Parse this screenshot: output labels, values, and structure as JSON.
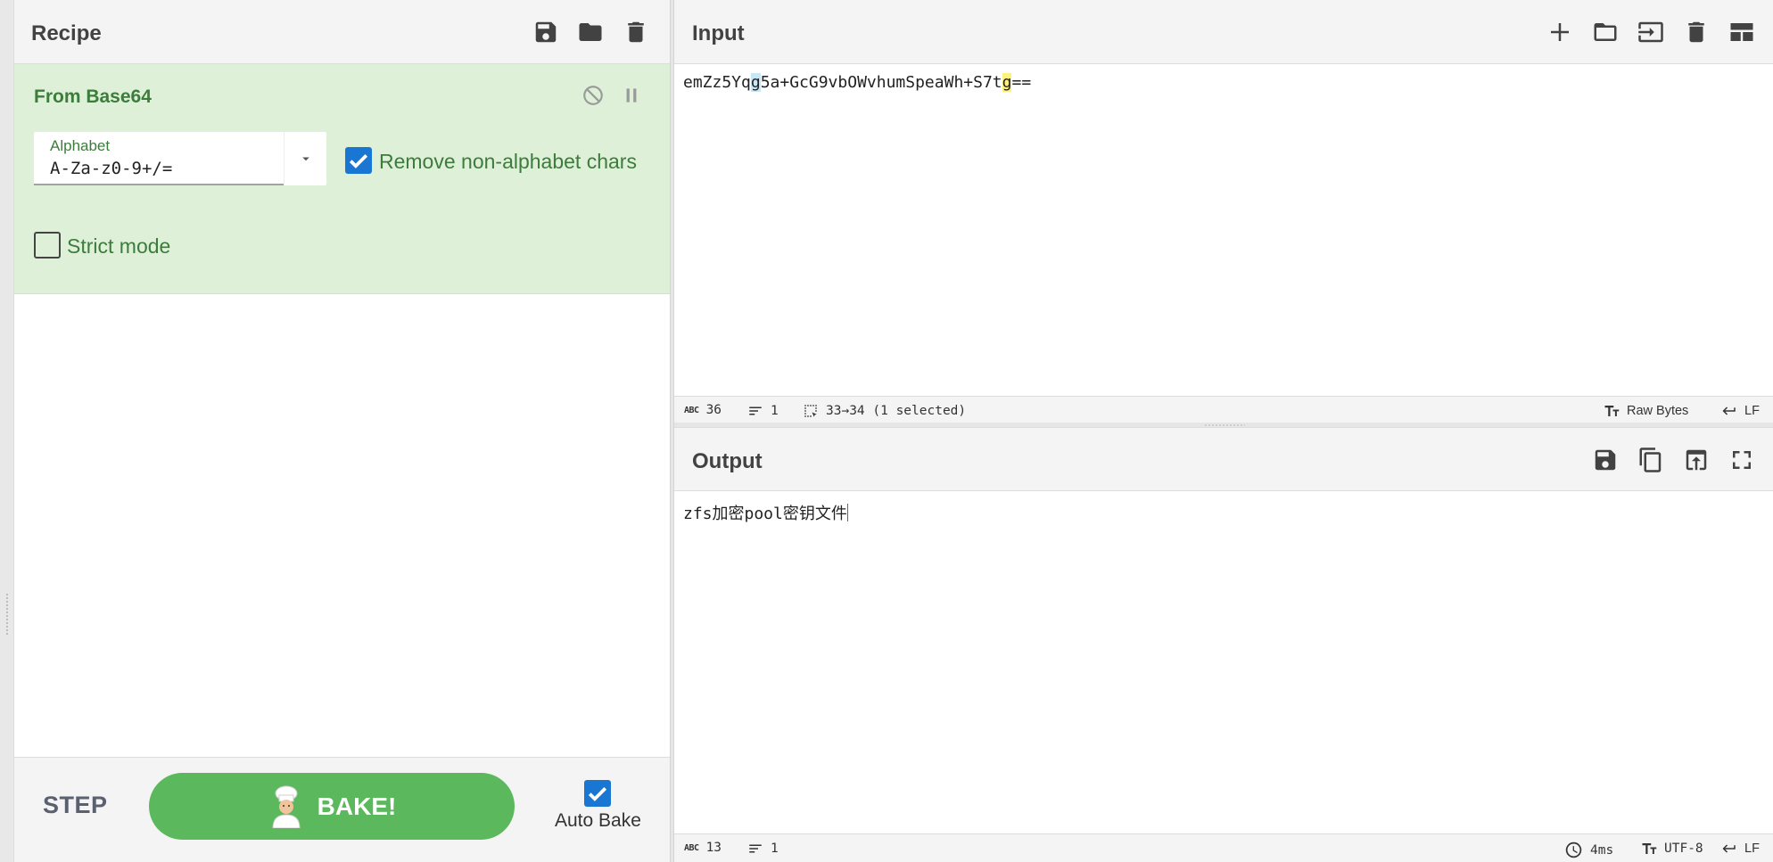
{
  "recipe": {
    "title": "Recipe",
    "operation": {
      "name": "From Base64",
      "alphabet_label": "Alphabet",
      "alphabet_value": "A-Za-z0-9+/=",
      "remove_non_alphabet_label": "Remove non-alphabet chars",
      "remove_non_alphabet_checked": true,
      "strict_mode_label": "Strict mode",
      "strict_mode_checked": false
    },
    "controls": {
      "step_label": "STEP",
      "bake_label": "BAKE!",
      "auto_bake_label": "Auto Bake",
      "auto_bake_checked": true
    }
  },
  "input": {
    "title": "Input",
    "text_before_sel": "emZz5Yq",
    "sel_char": "g",
    "text_mid": "5a+GcG9vbOWvhumSpeaWh+S7t",
    "match_char": "g",
    "text_after": "==",
    "status": {
      "length": "36",
      "lines": "1",
      "selection": "33→34 (1 selected)",
      "encoding": "Raw Bytes",
      "eol": "LF"
    }
  },
  "output": {
    "title": "Output",
    "text": "zfs加密pool密钥文件",
    "status": {
      "length": "13",
      "lines": "1",
      "time": "4ms",
      "encoding": "UTF-8",
      "eol": "LF"
    }
  },
  "colors": {
    "operation_bg": "#dff0d8",
    "operation_text": "#3c7c3c",
    "bake_button": "#5cb85c",
    "checkbox": "#1976d2"
  }
}
